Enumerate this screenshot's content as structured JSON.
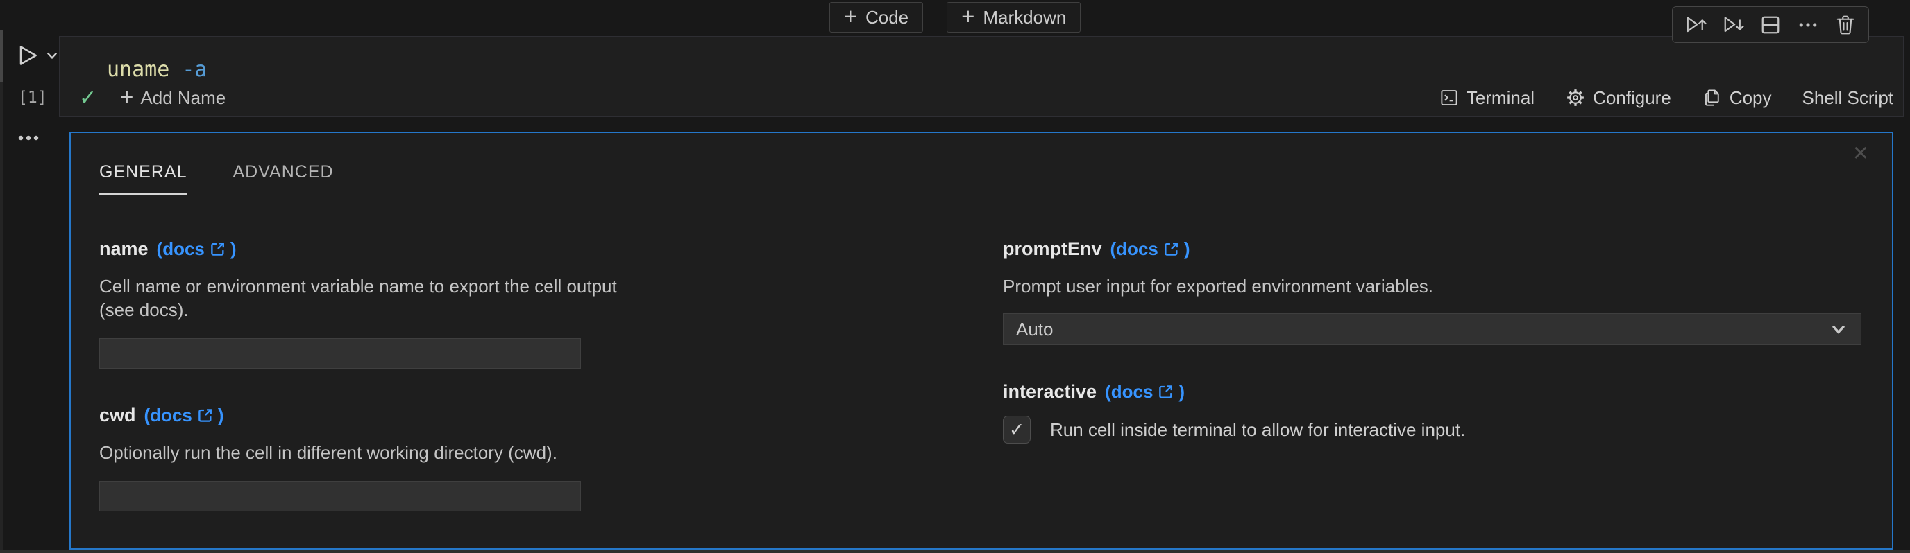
{
  "icons": {
    "plus": "+",
    "check": "✓",
    "close": "×"
  },
  "topbar": {
    "add_code_label": "Code",
    "add_markdown_label": "Markdown"
  },
  "cell_toolbar": {
    "buttons": [
      "execute-above",
      "execute-below",
      "split-cell",
      "more-actions",
      "delete"
    ]
  },
  "cell": {
    "code": {
      "command": "uname",
      "flag": " -a"
    },
    "execution_count": "[1]",
    "status_left": {
      "add_name_label": "Add Name"
    },
    "status_right": {
      "terminal_label": "Terminal",
      "configure_label": "Configure",
      "copy_label": "Copy",
      "language_label": "Shell Script"
    }
  },
  "panel": {
    "tabs": [
      {
        "label": "GENERAL"
      },
      {
        "label": "ADVANCED"
      }
    ],
    "docs_open": "(docs",
    "docs_close": ")",
    "fields": {
      "name": {
        "label": "name",
        "description": "Cell name or environment variable name to export the cell output (see docs).",
        "value": ""
      },
      "cwd": {
        "label": "cwd",
        "description": "Optionally run the cell in different working directory (cwd).",
        "value": ""
      },
      "promptEnv": {
        "label": "promptEnv",
        "description": "Prompt user input for exported environment variables.",
        "value": "Auto"
      },
      "interactive": {
        "label": "interactive",
        "checkbox_label": "Run cell inside terminal to allow for interactive input.",
        "checked": true
      }
    }
  },
  "colors": {
    "accent_blue": "#3794ff",
    "focus_border": "#2577c9",
    "success_green": "#73c991",
    "code_command": "#dcdcaa",
    "code_flag": "#569cd6"
  }
}
